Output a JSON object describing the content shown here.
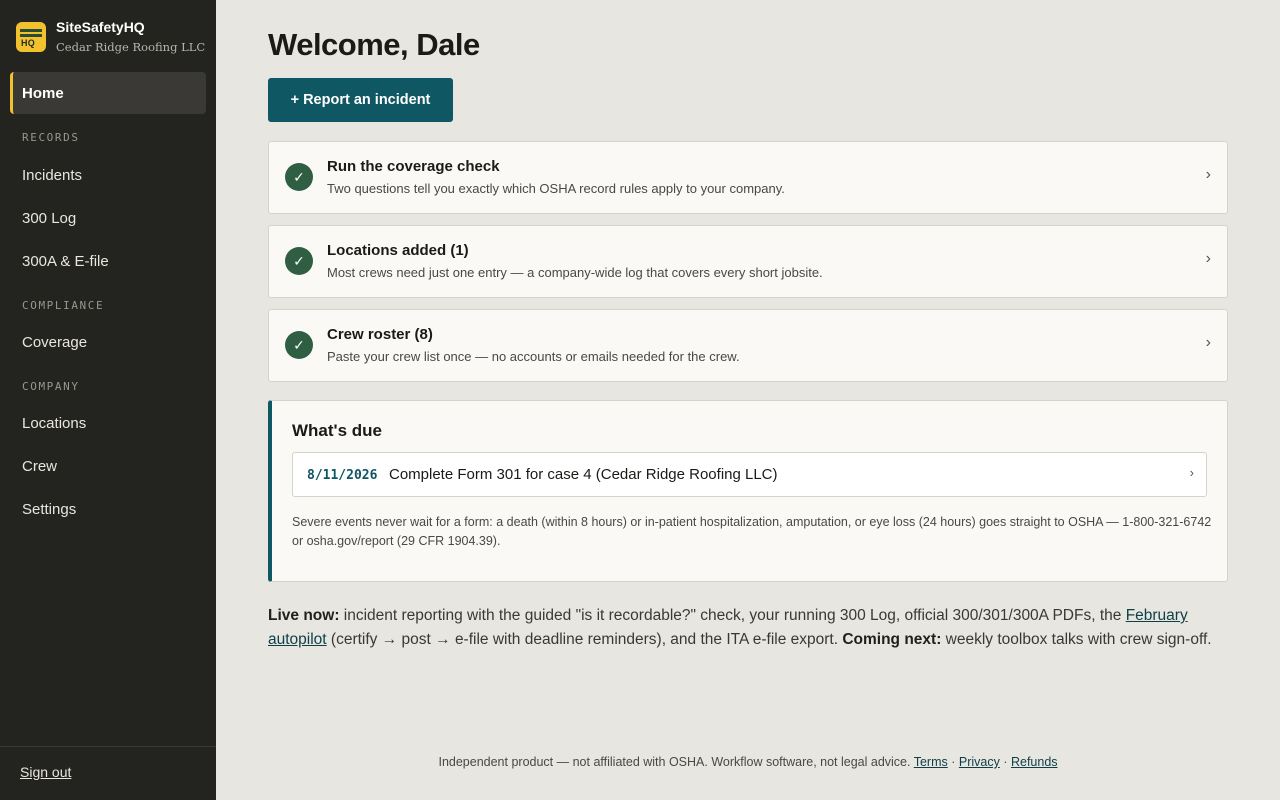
{
  "app": {
    "name": "SiteSafetyHQ",
    "company": "Cedar Ridge Roofing LLC",
    "logo_text": "HQ"
  },
  "sidebar": {
    "home": "Home",
    "sections": [
      {
        "label": "RECORDS",
        "items": [
          "Incidents",
          "300 Log",
          "300A & E-file"
        ]
      },
      {
        "label": "COMPLIANCE",
        "items": [
          "Coverage"
        ]
      },
      {
        "label": "COMPANY",
        "items": [
          "Locations",
          "Crew",
          "Settings"
        ]
      }
    ],
    "sign_out": "Sign out"
  },
  "main": {
    "title": "Welcome, Dale",
    "report_button": "+ Report an incident",
    "steps": [
      {
        "title": "Run the coverage check",
        "desc": "Two questions tell you exactly which OSHA record rules apply to your company."
      },
      {
        "title": "Locations added (1)",
        "desc": "Most crews need just one entry — a company-wide log that covers every short jobsite."
      },
      {
        "title": "Crew roster (8)",
        "desc": "Paste your crew list once — no accounts or emails needed for the crew."
      }
    ],
    "due": {
      "title": "What's due",
      "items": [
        {
          "date": "8/11/2026",
          "text": "Complete Form 301 for case 4 (Cedar Ridge Roofing LLC)"
        }
      ],
      "note": "Severe events never wait for a form: a death (within 8 hours) or in-patient hospitalization, amputation, or eye loss (24 hours) goes straight to OSHA — 1-800-321-6742 or osha.gov/report (29 CFR 1904.39)."
    },
    "live": {
      "label_now": "Live now:",
      "text_1": " incident reporting with the guided \"is it recordable?\" check, your running 300 Log, official 300/301/300A PDFs, the ",
      "link": "February autopilot",
      "text_2": " (certify → post → e-file with deadline reminders), and the ITA e-file export. ",
      "label_next": "Coming next:",
      "text_3": " weekly toolbox talks with crew sign-off."
    },
    "footer": {
      "text": "Independent product — not affiliated with OSHA. Workflow software, not legal advice. ",
      "terms": "Terms",
      "sep": " · ",
      "privacy": "Privacy",
      "refunds": "Refunds"
    }
  },
  "colors": {
    "sidebar_bg": "#232320",
    "accent": "#0e5763",
    "logo": "#f2c12e",
    "check": "#2f5e43",
    "page_bg": "#e8e6e1"
  }
}
